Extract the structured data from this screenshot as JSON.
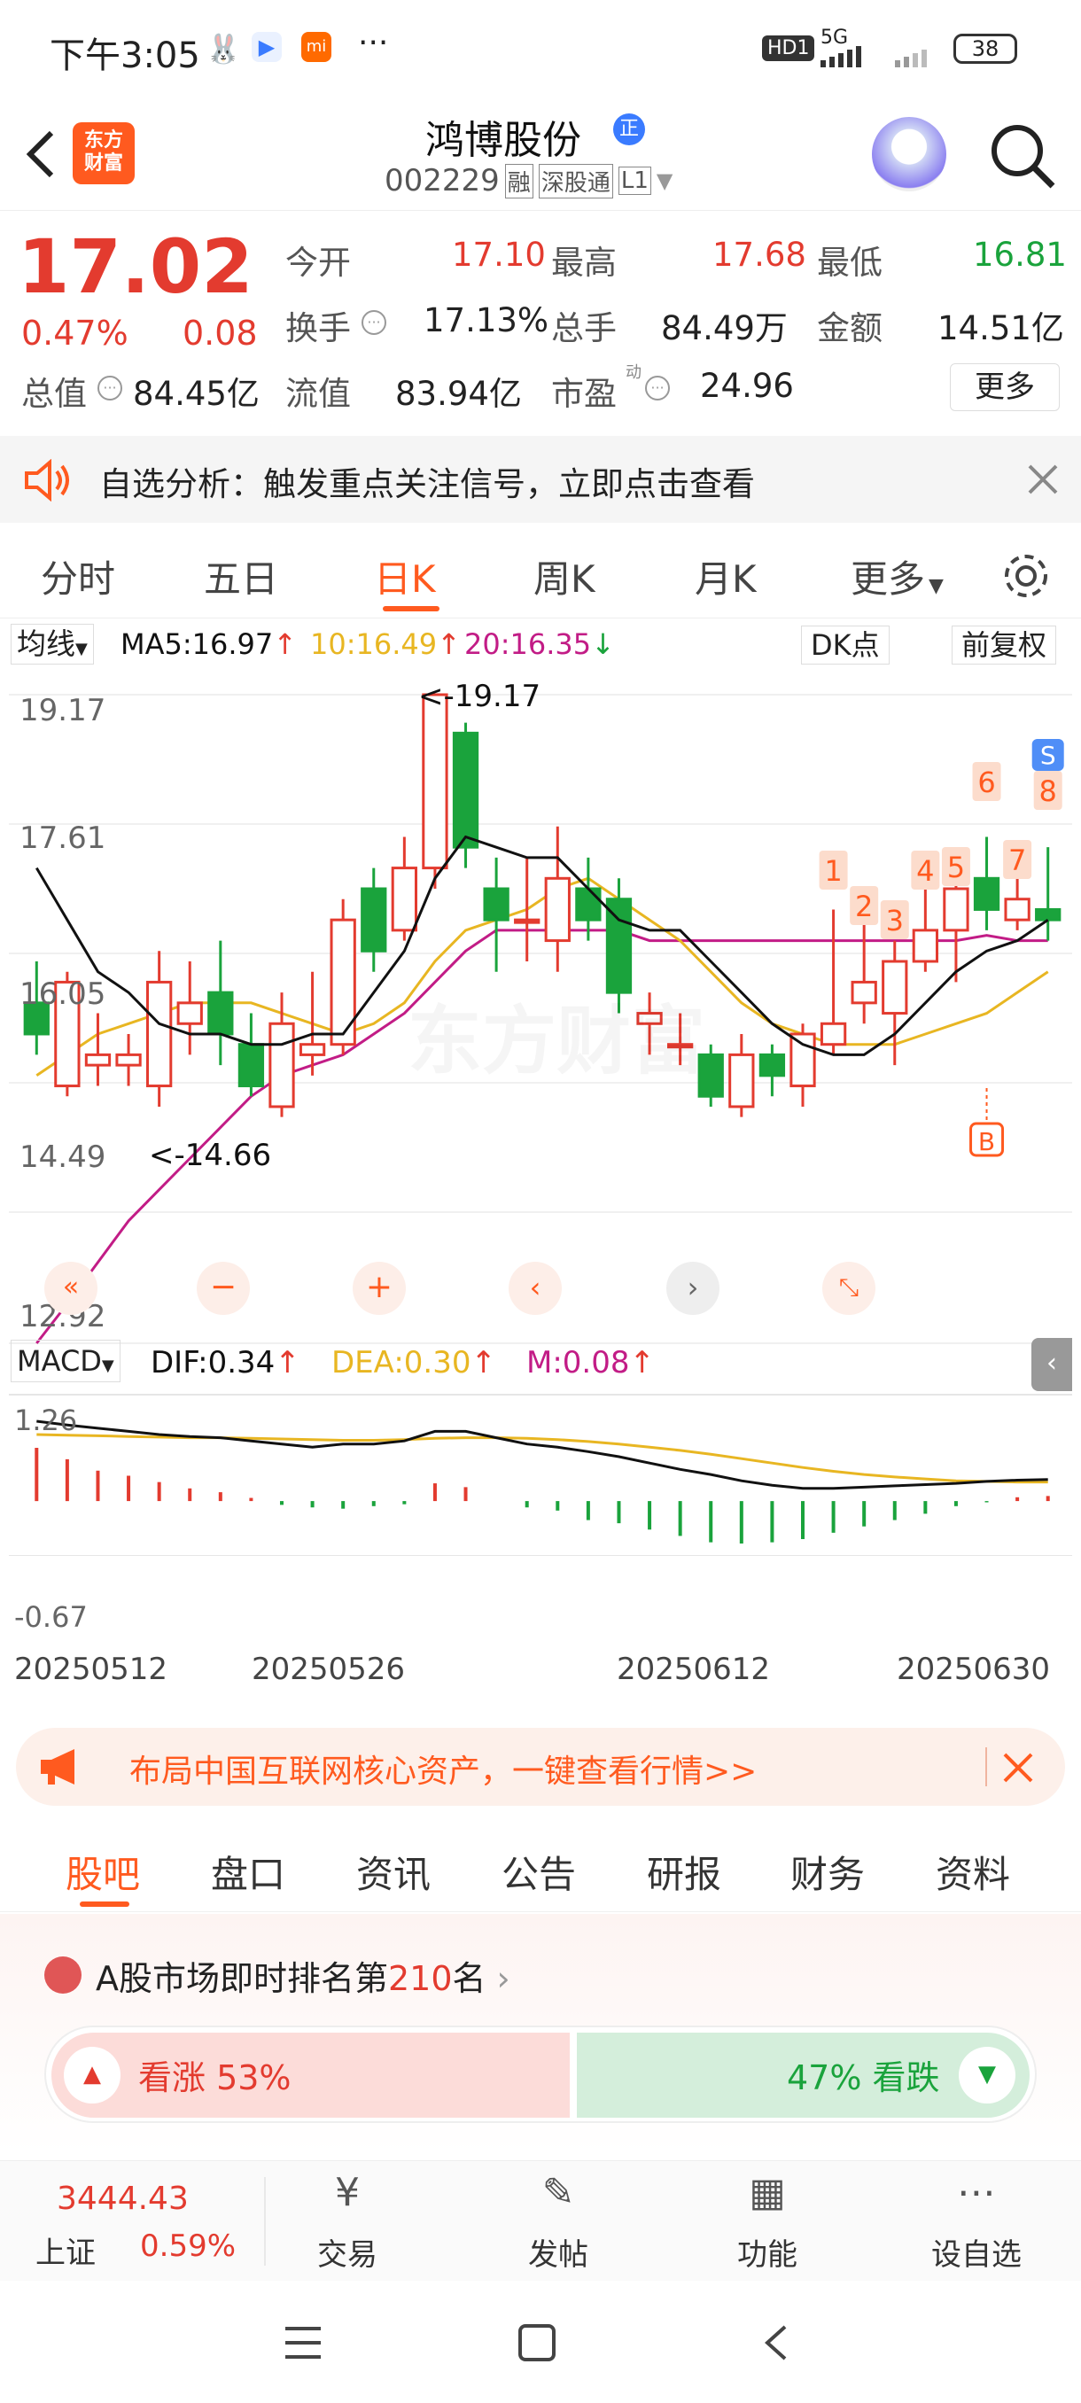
{
  "status_bar": {
    "time": "下午3:05",
    "network": "HD1",
    "signal": "5G",
    "battery": "38"
  },
  "header": {
    "logo_line1": "东方",
    "logo_line2": "财富",
    "stock_name": "鸿博股份",
    "name_badge": "正",
    "stock_code": "002229",
    "tags": [
      "融",
      "深股通",
      "L1"
    ]
  },
  "quote": {
    "price": "17.02",
    "change_pct": "0.47%",
    "change_abs": "0.08",
    "fields": [
      {
        "label": "今开",
        "value": "17.10",
        "color": "red"
      },
      {
        "label": "最高",
        "value": "17.68",
        "color": "red"
      },
      {
        "label": "最低",
        "value": "16.81",
        "color": "green"
      },
      {
        "label": "换手",
        "value": "17.13%",
        "color": "normal"
      },
      {
        "label": "总手",
        "value": "84.49万",
        "color": "normal"
      },
      {
        "label": "金额",
        "value": "14.51亿",
        "color": "normal"
      },
      {
        "label": "总值",
        "value": "84.45亿",
        "color": "normal"
      },
      {
        "label": "流值",
        "value": "83.94亿",
        "color": "normal"
      },
      {
        "label": "市盈",
        "value": "24.96",
        "color": "normal"
      }
    ],
    "pe_sup": "动",
    "more_button": "更多"
  },
  "alert": {
    "text": "自选分析：触发重点关注信号，立即点击查看"
  },
  "tabs": {
    "items": [
      "分时",
      "五日",
      "日K",
      "周K",
      "月K",
      "更多"
    ],
    "active_index": 2
  },
  "chart": {
    "indicator_select": "均线",
    "ma5": "MA5:16.97",
    "ma10": "10:16.49",
    "ma20": "20:16.35",
    "dk_button": "DK点",
    "adjust_button": "前复权",
    "y_labels": [
      "19.17",
      "17.61",
      "16.05",
      "14.49",
      "12.92"
    ],
    "high_annotation": "<-19.17",
    "low_annotation": "<-14.66",
    "macd_select": "MACD",
    "dif": "DIF:0.34",
    "dea": "DEA:0.30",
    "m": "M:0.08",
    "macd_y_labels": [
      "1.26",
      "-0.67"
    ],
    "dates": [
      "20250512",
      "20250526",
      "20250612",
      "20250630"
    ],
    "signal_labels": [
      "1",
      "2",
      "3",
      "4",
      "5",
      "6",
      "7",
      "8"
    ],
    "buy_label": "B",
    "sell_label": "S",
    "watermark": "东方财富"
  },
  "chart_data": {
    "type": "candlestick",
    "y_range": [
      12.92,
      19.17
    ],
    "candles": [
      [
        16.2,
        15.9,
        16.6,
        15.7
      ],
      [
        15.4,
        16.4,
        16.5,
        15.3
      ],
      [
        15.6,
        15.7,
        16.1,
        15.4
      ],
      [
        15.6,
        15.7,
        15.9,
        15.4
      ],
      [
        15.4,
        16.4,
        16.7,
        15.2
      ],
      [
        16.0,
        16.2,
        16.6,
        15.7
      ],
      [
        16.3,
        15.9,
        16.8,
        15.6
      ],
      [
        15.8,
        15.4,
        16.1,
        15.3
      ],
      [
        15.2,
        16.0,
        16.3,
        15.1
      ],
      [
        15.7,
        15.8,
        16.5,
        15.5
      ],
      [
        15.8,
        17.0,
        17.2,
        15.7
      ],
      [
        17.3,
        16.7,
        17.5,
        16.5
      ],
      [
        16.9,
        17.5,
        17.8,
        16.8
      ],
      [
        17.5,
        19.17,
        19.17,
        17.3
      ],
      [
        18.8,
        17.7,
        18.9,
        17.5
      ],
      [
        17.3,
        17.0,
        17.6,
        16.5
      ],
      [
        17.0,
        17.0,
        17.6,
        16.6
      ],
      [
        16.8,
        17.4,
        17.9,
        16.5
      ],
      [
        17.3,
        17.0,
        17.6,
        16.8
      ],
      [
        17.2,
        16.3,
        17.4,
        16.1
      ],
      [
        16.0,
        16.1,
        16.3,
        15.7
      ],
      [
        15.8,
        15.8,
        16.1,
        15.6
      ],
      [
        15.7,
        15.3,
        15.8,
        15.2
      ],
      [
        15.2,
        15.7,
        15.9,
        15.1
      ],
      [
        15.7,
        15.5,
        15.8,
        15.3
      ],
      [
        15.4,
        15.9,
        16.0,
        15.2
      ],
      [
        15.8,
        16.0,
        17.1,
        15.7
      ],
      [
        16.2,
        16.4,
        17.1,
        16.0
      ],
      [
        16.1,
        16.6,
        16.8,
        15.6
      ],
      [
        16.6,
        16.9,
        17.4,
        16.5
      ],
      [
        16.9,
        17.3,
        17.4,
        16.4
      ],
      [
        17.4,
        17.1,
        17.8,
        16.9
      ],
      [
        17.0,
        17.2,
        17.5,
        16.9
      ],
      [
        17.1,
        17.0,
        17.7,
        16.8
      ]
    ],
    "ma5": [
      17.5,
      17.0,
      16.5,
      16.3,
      16.0,
      15.9,
      15.9,
      15.8,
      15.8,
      15.9,
      15.9,
      16.3,
      16.7,
      17.4,
      17.8,
      17.7,
      17.6,
      17.6,
      17.3,
      17.0,
      16.9,
      16.9,
      16.6,
      16.3,
      16.0,
      15.8,
      15.7,
      15.7,
      15.9,
      16.2,
      16.5,
      16.7,
      16.8,
      17.0
    ],
    "ma10": [
      15.5,
      15.7,
      15.9,
      16.0,
      16.1,
      16.2,
      16.2,
      16.2,
      16.1,
      16.0,
      15.9,
      16.0,
      16.2,
      16.6,
      16.9,
      17.0,
      17.1,
      17.3,
      17.4,
      17.2,
      17.0,
      16.8,
      16.5,
      16.2,
      16.0,
      15.9,
      15.8,
      15.8,
      15.8,
      15.9,
      16.0,
      16.1,
      16.3,
      16.5
    ],
    "ma20": [
      12.92,
      13.3,
      13.7,
      14.1,
      14.4,
      14.7,
      15.0,
      15.3,
      15.5,
      15.6,
      15.7,
      15.9,
      16.1,
      16.4,
      16.7,
      16.9,
      16.9,
      16.9,
      16.9,
      16.9,
      16.8,
      16.8,
      16.8,
      16.8,
      16.8,
      16.8,
      16.8,
      16.8,
      16.8,
      16.8,
      16.8,
      16.85,
      16.8,
      16.8
    ],
    "macd_range": [
      -0.67,
      1.26
    ],
    "dif": [
      1.26,
      1.2,
      1.15,
      1.1,
      1.05,
      1.02,
      1.0,
      0.95,
      0.9,
      0.85,
      0.9,
      0.9,
      0.95,
      1.1,
      1.1,
      1.0,
      0.9,
      0.85,
      0.78,
      0.7,
      0.6,
      0.5,
      0.42,
      0.32,
      0.25,
      0.2,
      0.2,
      0.22,
      0.24,
      0.26,
      0.28,
      0.31,
      0.33,
      0.34
    ],
    "dea": [
      1.05,
      1.04,
      1.03,
      1.02,
      1.01,
      1.0,
      1.0,
      0.99,
      0.98,
      0.97,
      0.96,
      0.96,
      0.97,
      0.99,
      1.0,
      1.0,
      0.99,
      0.97,
      0.94,
      0.9,
      0.85,
      0.8,
      0.74,
      0.67,
      0.6,
      0.53,
      0.47,
      0.42,
      0.38,
      0.35,
      0.32,
      0.31,
      0.3,
      0.3
    ],
    "macd": [
      0.84,
      0.66,
      0.48,
      0.4,
      0.3,
      0.2,
      0.14,
      0.05,
      -0.06,
      -0.1,
      -0.12,
      -0.08,
      -0.05,
      0.28,
      0.22,
      0.0,
      -0.1,
      -0.15,
      -0.3,
      -0.35,
      -0.45,
      -0.55,
      -0.65,
      -0.67,
      -0.65,
      -0.6,
      -0.5,
      -0.4,
      -0.3,
      -0.2,
      -0.08,
      -0.02,
      0.06,
      0.08
    ]
  },
  "promo": {
    "text": "布局中国互联网核心资产，一键查看行情>>"
  },
  "sub_tabs": {
    "items": [
      "股吧",
      "盘口",
      "资讯",
      "公告",
      "研报",
      "财务",
      "资料"
    ],
    "active_index": 0
  },
  "rank": {
    "prefix": "A股市场即时排名第",
    "number": "210",
    "suffix": "名",
    "bull_label": "看涨 53%",
    "bear_label": "47% 看跌",
    "bull_pct": 53
  },
  "bottom_nav": {
    "index_value": "3444.43",
    "index_name": "上证",
    "index_change": "0.59%",
    "items": [
      "交易",
      "发帖",
      "功能",
      "设自选"
    ]
  },
  "colors": {
    "up": "#e33b2f",
    "down": "#1aa33c",
    "accent": "#ff5a1f",
    "ma5": "#111111",
    "ma10": "#e8b622",
    "ma20": "#c21c86"
  }
}
